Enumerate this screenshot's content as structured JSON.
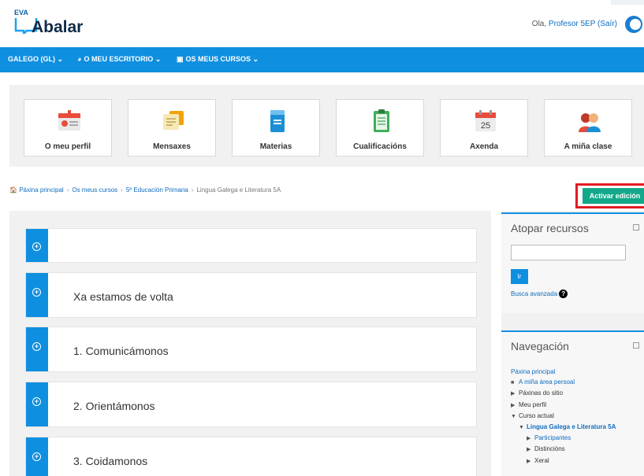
{
  "header": {
    "logo_small": "EVA",
    "logo_name": "Abalar",
    "greeting": "Ola, ",
    "user_link": "Profesor 5EP (Saír)"
  },
  "nav": {
    "items": [
      {
        "label": "GALEGO (GL)",
        "icon": "chevron-down-icon"
      },
      {
        "label": "O MEU ESCRITORIO",
        "icon": "dashboard-icon"
      },
      {
        "label": "OS MEUS CURSOS",
        "icon": "briefcase-icon"
      }
    ]
  },
  "tiles": [
    {
      "label": "O meu perfil",
      "icon": "profile-card-icon"
    },
    {
      "label": "Mensaxes",
      "icon": "messages-icon"
    },
    {
      "label": "Materias",
      "icon": "book-icon"
    },
    {
      "label": "Cualificacións",
      "icon": "clipboard-icon"
    },
    {
      "label": "Axenda",
      "icon": "calendar-icon",
      "day": "25"
    },
    {
      "label": "A miña clase",
      "icon": "class-people-icon"
    }
  ],
  "breadcrumb": {
    "items": [
      "Páxina principal",
      "Os meus cursos",
      "5º Educación Primaria",
      "Lingua Galega e Literatura 5A"
    ]
  },
  "actions": {
    "edit_label": "Activar edición"
  },
  "sections": [
    {
      "title": ""
    },
    {
      "title": "Xa estamos de volta"
    },
    {
      "title": "1. Comunicámonos"
    },
    {
      "title": "2. Orientámonos"
    },
    {
      "title": "3. Coidamonos"
    }
  ],
  "search_block": {
    "title": "Atopar recursos",
    "go_label": "Ir",
    "advanced_label": "Busca avanzada"
  },
  "navigation_block": {
    "title": "Navegación",
    "items": [
      {
        "label": "Páxina principal"
      },
      {
        "label": "A miña área persoal"
      },
      {
        "label": "Páxinas do sitio"
      },
      {
        "label": "Meu perfil"
      },
      {
        "label": "Curso actual"
      },
      {
        "label": "Lingua Galega e Literatura 5A"
      },
      {
        "label": "Participantes"
      },
      {
        "label": "Distincións"
      },
      {
        "label": "Xeral"
      }
    ]
  },
  "colors": {
    "nav_blue": "#0f8fe0",
    "edit_green": "#13a889",
    "highlight_red": "#e21b23"
  }
}
